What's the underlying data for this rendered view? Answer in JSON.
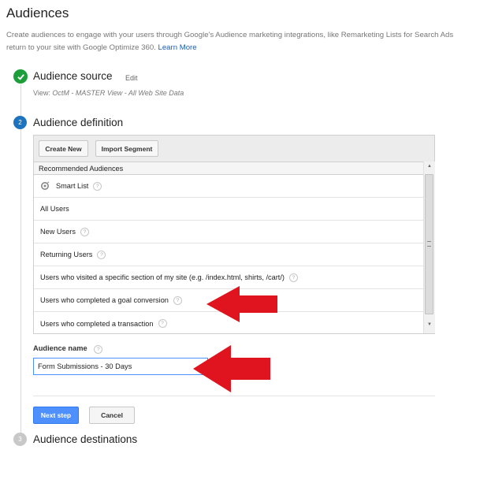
{
  "page": {
    "title": "Audiences",
    "description": "Create audiences to engage with your users through Google's Audience marketing integrations, like Remarketing Lists for Search Ads",
    "description_line2": "return to your site with Google Optimize 360.",
    "learn_more": "Learn More"
  },
  "steps": {
    "source": {
      "title": "Audience source",
      "edit": "Edit",
      "view_label": "View:",
      "view_value": "OctM - MASTER View - All Web Site Data",
      "status_icon": "checkmark-icon"
    },
    "definition": {
      "number": "2",
      "title": "Audience definition",
      "create_new": "Create New",
      "import_segment": "Import Segment",
      "list_header": "Recommended Audiences",
      "items": [
        {
          "label": "Smart List",
          "help": "?"
        },
        {
          "label": "All Users",
          "help": ""
        },
        {
          "label": "New Users",
          "help": "?"
        },
        {
          "label": "Returning Users",
          "help": "?"
        },
        {
          "label": "Users who visited a specific section of my site (e.g. /index.html, shirts, /cart/)",
          "help": "?"
        },
        {
          "label": "Users who completed a goal conversion",
          "help": "?"
        },
        {
          "label": "Users who completed a transaction",
          "help": "?"
        }
      ],
      "audience_name_label": "Audience name",
      "audience_name_help": "?",
      "audience_name_value": "Form Submissions - 30 Days",
      "next_step": "Next step",
      "cancel": "Cancel"
    },
    "destinations": {
      "number": "3",
      "title": "Audience destinations"
    }
  },
  "colors": {
    "accent_blue": "#4d90fe",
    "step_done": "#1e9e3a",
    "step_active": "#1e73be",
    "step_inactive": "#c8c8c8",
    "annotation_arrow": "#e0141e"
  }
}
